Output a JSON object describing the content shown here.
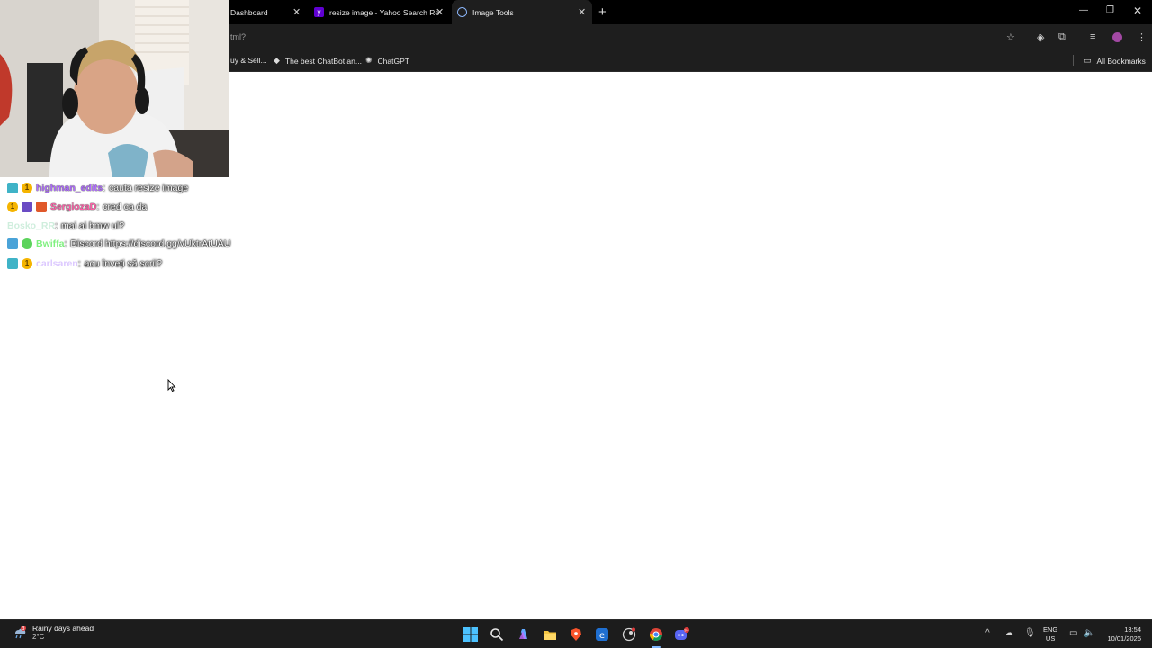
{
  "browser": {
    "tabs": [
      {
        "title": "Dashboard",
        "active": false
      },
      {
        "title": "resize image - Yahoo Search Re",
        "active": false
      },
      {
        "title": "Image Tools",
        "active": true
      }
    ],
    "omnibox_text": "tml?",
    "bookmarks": [
      {
        "label": "uy & Sell..."
      },
      {
        "label": "The best ChatBot an..."
      },
      {
        "label": "ChatGPT"
      }
    ],
    "all_bookmarks_label": "All Bookmarks"
  },
  "chat": {
    "messages": [
      {
        "user": "highman_edits",
        "separator": ":",
        "text": "cauta resize image",
        "user_color": "#b06cff"
      },
      {
        "user": "SergiozaD",
        "separator": ":",
        "text": "cred ca da",
        "user_color": "#ff5fa8"
      },
      {
        "user": "Bosko_RR",
        "separator": ":",
        "text": "mai ai bmw ul?",
        "user_color": "#8fe6b0"
      },
      {
        "user": "Bwiffa",
        "separator": ":",
        "text": "Discord https://discord.gg/vUktrAtUAU",
        "user_color": "#4cdc4c"
      },
      {
        "user": "carlsaren",
        "separator": ":",
        "text": "acu înveți să scrii?",
        "user_color": "#c9a7ff"
      }
    ]
  },
  "taskbar": {
    "weather_title": "Rainy days ahead",
    "weather_temp": "2°C",
    "weather_badge": "3",
    "lang_primary": "ENG",
    "lang_secondary": "US",
    "time": "13:54",
    "date": "10/01/2026",
    "discord_badge": "9+"
  },
  "colors": {
    "chrome_bg": "#1e1e1e",
    "tabbar_bg": "#000000",
    "page_bg": "#ffffff",
    "taskbar_bg": "#1c1c1c"
  }
}
